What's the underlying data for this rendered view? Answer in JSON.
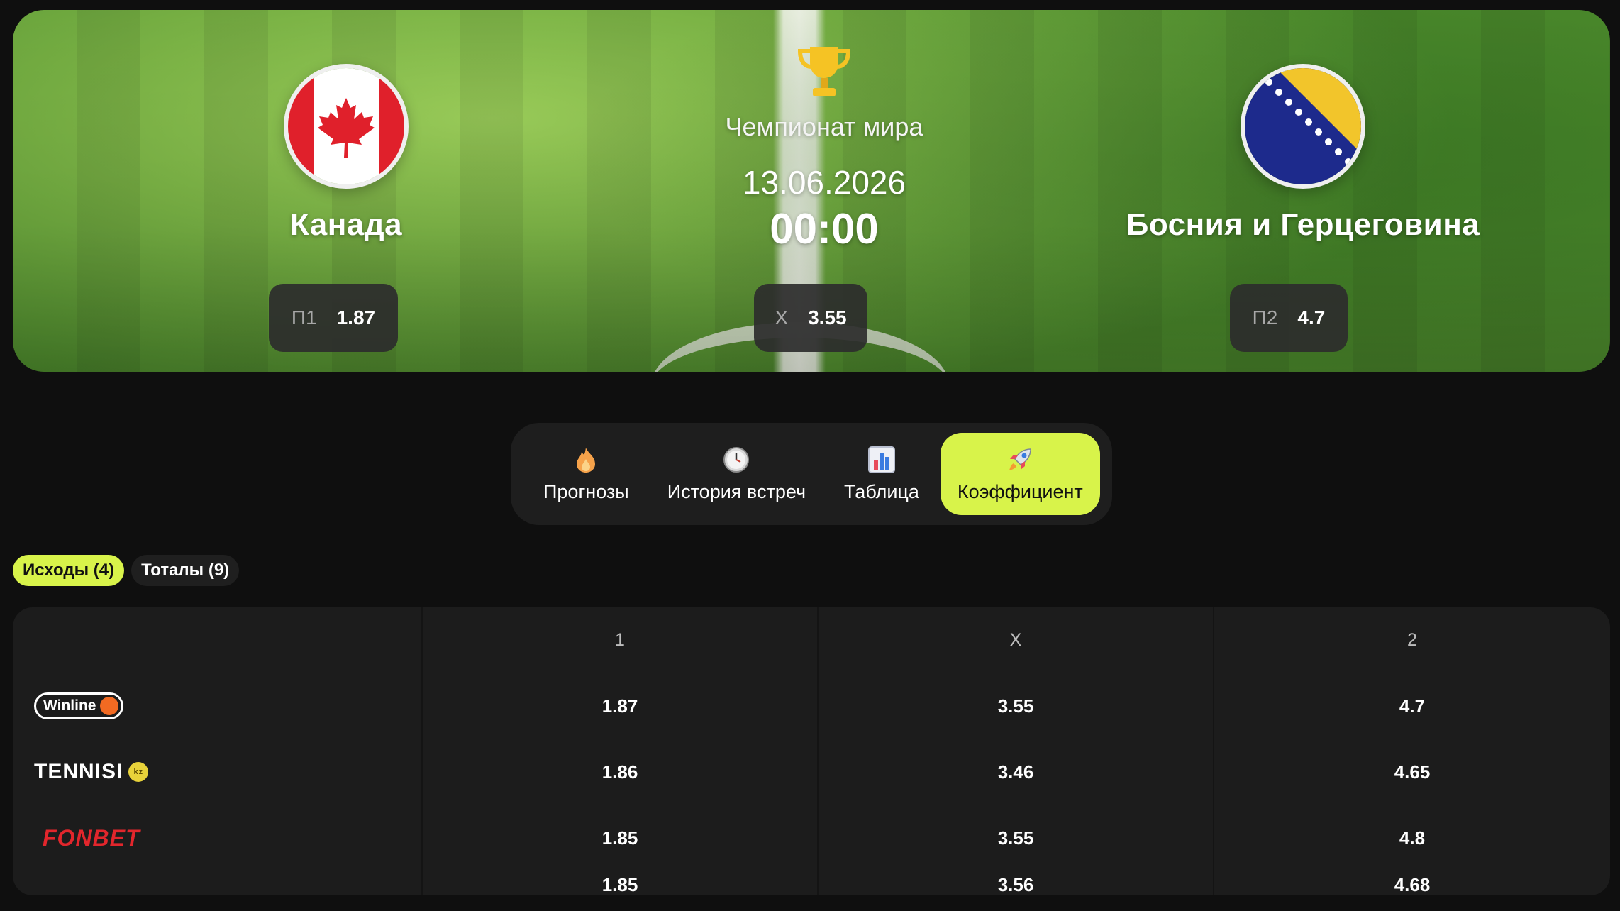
{
  "match": {
    "tournament": "Чемпионат мира",
    "date": "13.06.2026",
    "time": "00:00",
    "home": {
      "name": "Канада",
      "flag_icon": "canada-flag-icon"
    },
    "away": {
      "name": "Босния и Герцеговина",
      "flag_icon": "bosnia-flag-icon"
    },
    "odds": [
      {
        "label": "П1",
        "value": "1.87"
      },
      {
        "label": "X",
        "value": "3.55"
      },
      {
        "label": "П2",
        "value": "4.7"
      }
    ]
  },
  "tabs": [
    {
      "label": "Прогнозы",
      "icon": "fire-icon",
      "active": false
    },
    {
      "label": "История встреч",
      "icon": "clock-icon",
      "active": false
    },
    {
      "label": "Таблица",
      "icon": "bar-chart-icon",
      "active": false
    },
    {
      "label": "Коэффициент",
      "icon": "rocket-icon",
      "active": true
    }
  ],
  "filters": [
    {
      "label": "Исходы (4)",
      "active": true
    },
    {
      "label": "Тоталы (9)",
      "active": false
    }
  ],
  "table": {
    "headers": [
      "",
      "1",
      "X",
      "2"
    ],
    "rows": [
      {
        "bookmaker": "Winline",
        "logo_icon": "winline-logo",
        "values": [
          "1.87",
          "3.55",
          "4.7"
        ]
      },
      {
        "bookmaker": "TENNISI",
        "badge": "kz",
        "logo_icon": "tennisi-logo",
        "values": [
          "1.86",
          "3.46",
          "4.65"
        ]
      },
      {
        "bookmaker": "FONBET",
        "logo_icon": "fonbet-logo",
        "values": [
          "1.85",
          "3.55",
          "4.8"
        ]
      },
      {
        "bookmaker": "",
        "values": [
          "1.85",
          "3.56",
          "4.68"
        ]
      }
    ]
  },
  "colors": {
    "accent": "#d8f34a",
    "background": "#0f0f0f",
    "panel": "#1c1c1c",
    "winline_dot": "#f26a22",
    "fonbet_red": "#e2262c"
  }
}
